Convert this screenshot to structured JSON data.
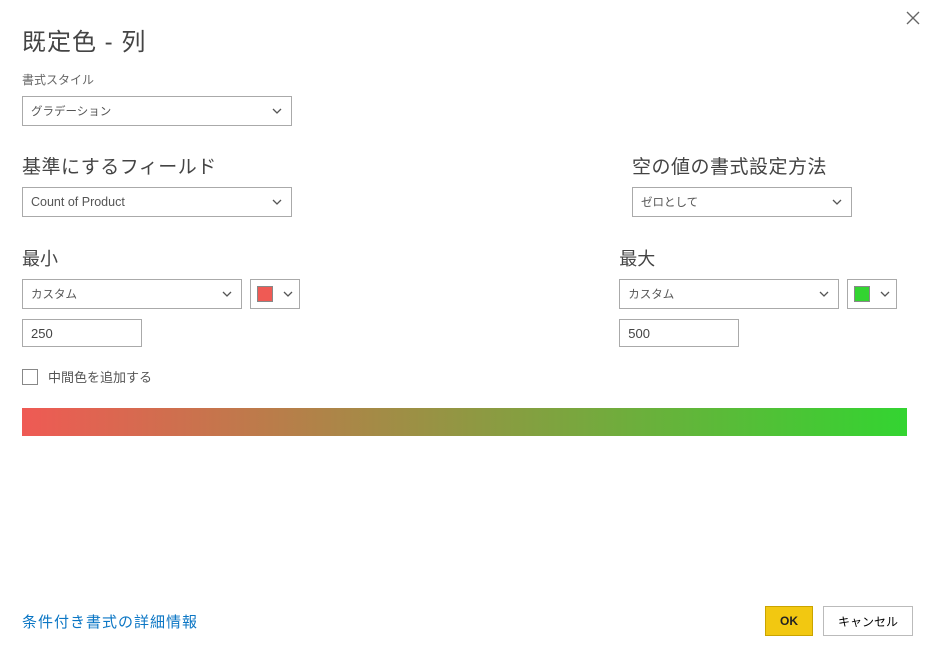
{
  "header": {
    "title": "既定色 -   列"
  },
  "style": {
    "label": "書式スタイル",
    "value": "グラデーション"
  },
  "field": {
    "label": "基準にするフィールド",
    "value": "Count of Product"
  },
  "empty": {
    "label": "空の値の書式設定方法",
    "value": "ゼロとして"
  },
  "min": {
    "label": "最小",
    "mode": "カスタム",
    "color": "#ef5a54",
    "value": "250"
  },
  "max": {
    "label": "最大",
    "mode": "カスタム",
    "color": "#33d431",
    "value": "500"
  },
  "midCheckbox": {
    "label": "中間色を追加する",
    "checked": false
  },
  "gradient": {
    "from": "#ef5a54",
    "to": "#33d431"
  },
  "footer": {
    "linkText": "条件付き書式の詳細情報",
    "ok": "OK",
    "cancel": "キャンセル"
  }
}
